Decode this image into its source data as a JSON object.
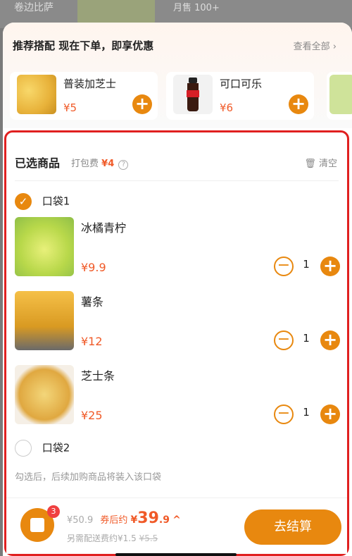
{
  "background": {
    "product_title": "卷边比萨",
    "sales": "月售 100+"
  },
  "recommend": {
    "title": "推荐搭配  现在下单，即享优惠",
    "view_all": "查看全部 ›",
    "items": [
      {
        "name": "普装加芝士",
        "price": "¥5"
      },
      {
        "name": "可口可乐",
        "price": "¥6"
      }
    ]
  },
  "selected": {
    "title": "已选商品",
    "packing_label": "打包费",
    "packing_fee": "¥4",
    "help_icon": "?",
    "clear_label": "清空",
    "bag1": {
      "label": "口袋1",
      "checked": true
    },
    "items": [
      {
        "name": "冰橘青柠",
        "price": "¥9.9",
        "qty": "1"
      },
      {
        "name": "薯条",
        "price": "¥12",
        "qty": "1"
      },
      {
        "name": "芝士条",
        "price": "¥25",
        "qty": "1"
      }
    ],
    "bag2": {
      "label": "口袋2",
      "checked": false
    },
    "hint": "勾选后，后续加购商品将装入该口袋"
  },
  "footer": {
    "cart_count": "3",
    "original_total": "¥50.9",
    "after_coupon_label": "券后约",
    "currency": "¥",
    "after_coupon_int": "39",
    "after_coupon_dec": ".9",
    "chevron": "^",
    "delivery_label": "另需配送费约¥1.5",
    "delivery_original": "¥5.5",
    "checkout_label": "去结算"
  },
  "colors": {
    "accent": "#e8880f",
    "price": "#f05a28",
    "highlight_border": "#e02020"
  }
}
